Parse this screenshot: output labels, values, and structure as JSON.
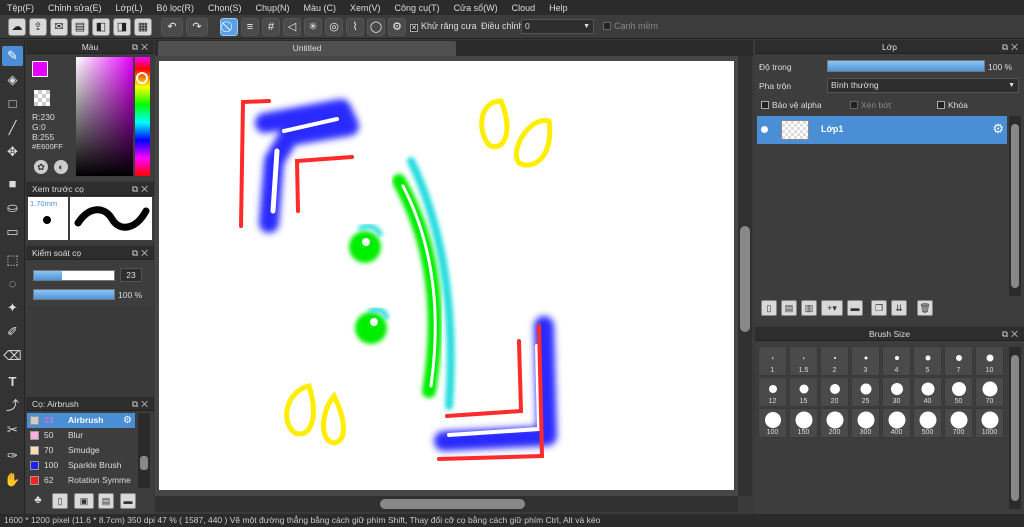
{
  "menu": [
    "Tệp(F)",
    "Chỉnh sửa(E)",
    "Lớp(L)",
    "Bộ lọc(R)",
    "Chọn(S)",
    "Chụp(N)",
    "Màu (C)",
    "Xem(V)",
    "Công cụ(T)",
    "Cửa sổ(W)",
    "Cloud",
    "Help"
  ],
  "toolbar": {
    "antialias_label": "Khử răng cưa",
    "correction_label": "Điều chỉnh",
    "correction_value": "0",
    "edge_label": "Cạnh mềm"
  },
  "color_panel": {
    "title": "Màu",
    "r": "R:230",
    "g": "G:0",
    "b": "B:255",
    "hex": "#E600FF",
    "fg_color": "#E600FF"
  },
  "brush_preview": {
    "title": "Xem trước cọ",
    "size": "1.70mm"
  },
  "brush_control": {
    "title": "Kiểm soát cọ",
    "size_value": "23",
    "size_fraction": 0.35,
    "opacity_value": "100 %",
    "opacity_fraction": 1.0
  },
  "brush_list": {
    "title": "Cọ: Airbrush",
    "items": [
      {
        "size": "23",
        "name": "Airbrush",
        "color": "#cccccc",
        "selected": true
      },
      {
        "size": "50",
        "name": "Blur",
        "color": "#ffb0e0",
        "selected": false
      },
      {
        "size": "70",
        "name": "Smudge",
        "color": "#ffd8b8",
        "selected": false
      },
      {
        "size": "100",
        "name": "Sparkle Brush",
        "color": "#2020ff",
        "selected": false
      },
      {
        "size": "62",
        "name": "Rotation Symme",
        "color": "#ff2020",
        "selected": false
      }
    ]
  },
  "document": {
    "tab_title": "Untitled"
  },
  "layer_panel": {
    "title": "Lớp",
    "opacity_label": "Độ trong",
    "opacity_value": "100 %",
    "opacity_fraction": 1.0,
    "blend_label": "Pha trộn",
    "blend_value": "Bình thường",
    "protect_alpha": "Bảo vệ alpha",
    "clipping": "Xén bớt",
    "lock": "Khóa",
    "layers": [
      {
        "name": "Lớp1"
      }
    ]
  },
  "brush_size_panel": {
    "title": "Brush Size",
    "sizes": [
      "1",
      "1.5",
      "2",
      "3",
      "4",
      "5",
      "7",
      "10",
      "12",
      "15",
      "20",
      "25",
      "30",
      "40",
      "50",
      "70",
      "100",
      "150",
      "200",
      "300",
      "400",
      "500",
      "700",
      "1000"
    ]
  },
  "status": "1600 * 1200 pixel  (11.6 * 8.7cm)  350 dpi  47 %  ( 1587, 440 )  Vẽ một đường thẳng bằng cách giữ phím Shift, Thay đổi cỡ cọ bằng cách giữ phím Ctrl, Alt và kéo",
  "colors": {
    "accent": "#4a8fd6",
    "panel_bg": "#3d3d3d",
    "header_bg": "#2d2d2d"
  }
}
